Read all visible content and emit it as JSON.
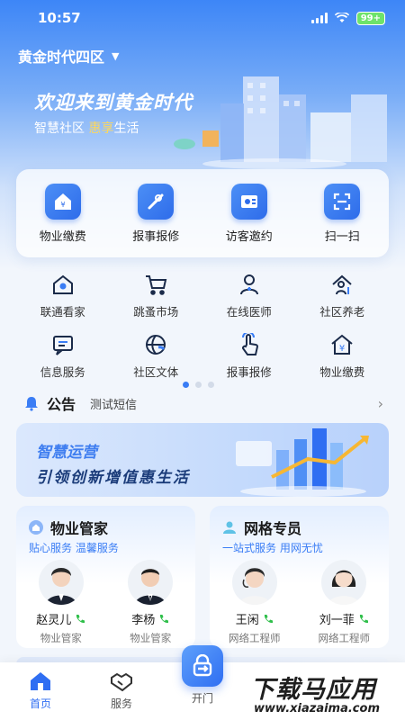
{
  "status_bar": {
    "time": "10:57",
    "battery": "99+"
  },
  "header": {
    "community": "黄金时代四区",
    "welcome": "欢迎来到黄金时代",
    "tagline_prefix": "智慧社区",
    "tagline_accent": "惠享",
    "tagline_suffix": "生活"
  },
  "main_services": [
    {
      "label": "物业缴费",
      "icon": "property-fee-icon"
    },
    {
      "label": "报事报修",
      "icon": "repair-tools-icon"
    },
    {
      "label": "访客邀约",
      "icon": "visitor-invite-icon"
    },
    {
      "label": "扫一扫",
      "icon": "scan-icon"
    }
  ],
  "services": [
    {
      "label": "联通看家",
      "icon": "home-camera-icon"
    },
    {
      "label": "跳蚤市场",
      "icon": "shopping-cart-icon"
    },
    {
      "label": "在线医师",
      "icon": "doctor-icon"
    },
    {
      "label": "社区养老",
      "icon": "elderly-care-icon"
    },
    {
      "label": "信息服务",
      "icon": "message-icon"
    },
    {
      "label": "社区文体",
      "icon": "sports-ball-icon"
    },
    {
      "label": "报事报修",
      "icon": "tap-hand-icon"
    },
    {
      "label": "物业缴费",
      "icon": "house-yen-icon"
    }
  ],
  "pager": {
    "total": 3,
    "active": 0
  },
  "notice": {
    "title": "公告",
    "text": "测试短信"
  },
  "banner": {
    "title": "智慧运营",
    "subtitle": "引领创新增值惠生活"
  },
  "property_panel": {
    "title": "物业管家",
    "subtitle": "贴心服务 温馨服务",
    "people": [
      {
        "name": "赵灵儿",
        "role": "物业管家"
      },
      {
        "name": "李杨",
        "role": "物业管家"
      }
    ]
  },
  "network_panel": {
    "title": "网格专员",
    "subtitle": "一站式服务 用网无忧",
    "people": [
      {
        "name": "王闲",
        "role": "网络工程师"
      },
      {
        "name": "刘一菲",
        "role": "网络工程师"
      }
    ]
  },
  "tabbar": [
    {
      "label": "首页",
      "active": true
    },
    {
      "label": "服务",
      "active": false
    },
    {
      "label": "开门",
      "active": false
    }
  ],
  "watermark": {
    "main": "下载马应用",
    "url": "www.xiazaima.com"
  },
  "colors": {
    "primary": "#2f6ef2",
    "accent": "#ffd85b",
    "call": "#2fbf4a"
  }
}
